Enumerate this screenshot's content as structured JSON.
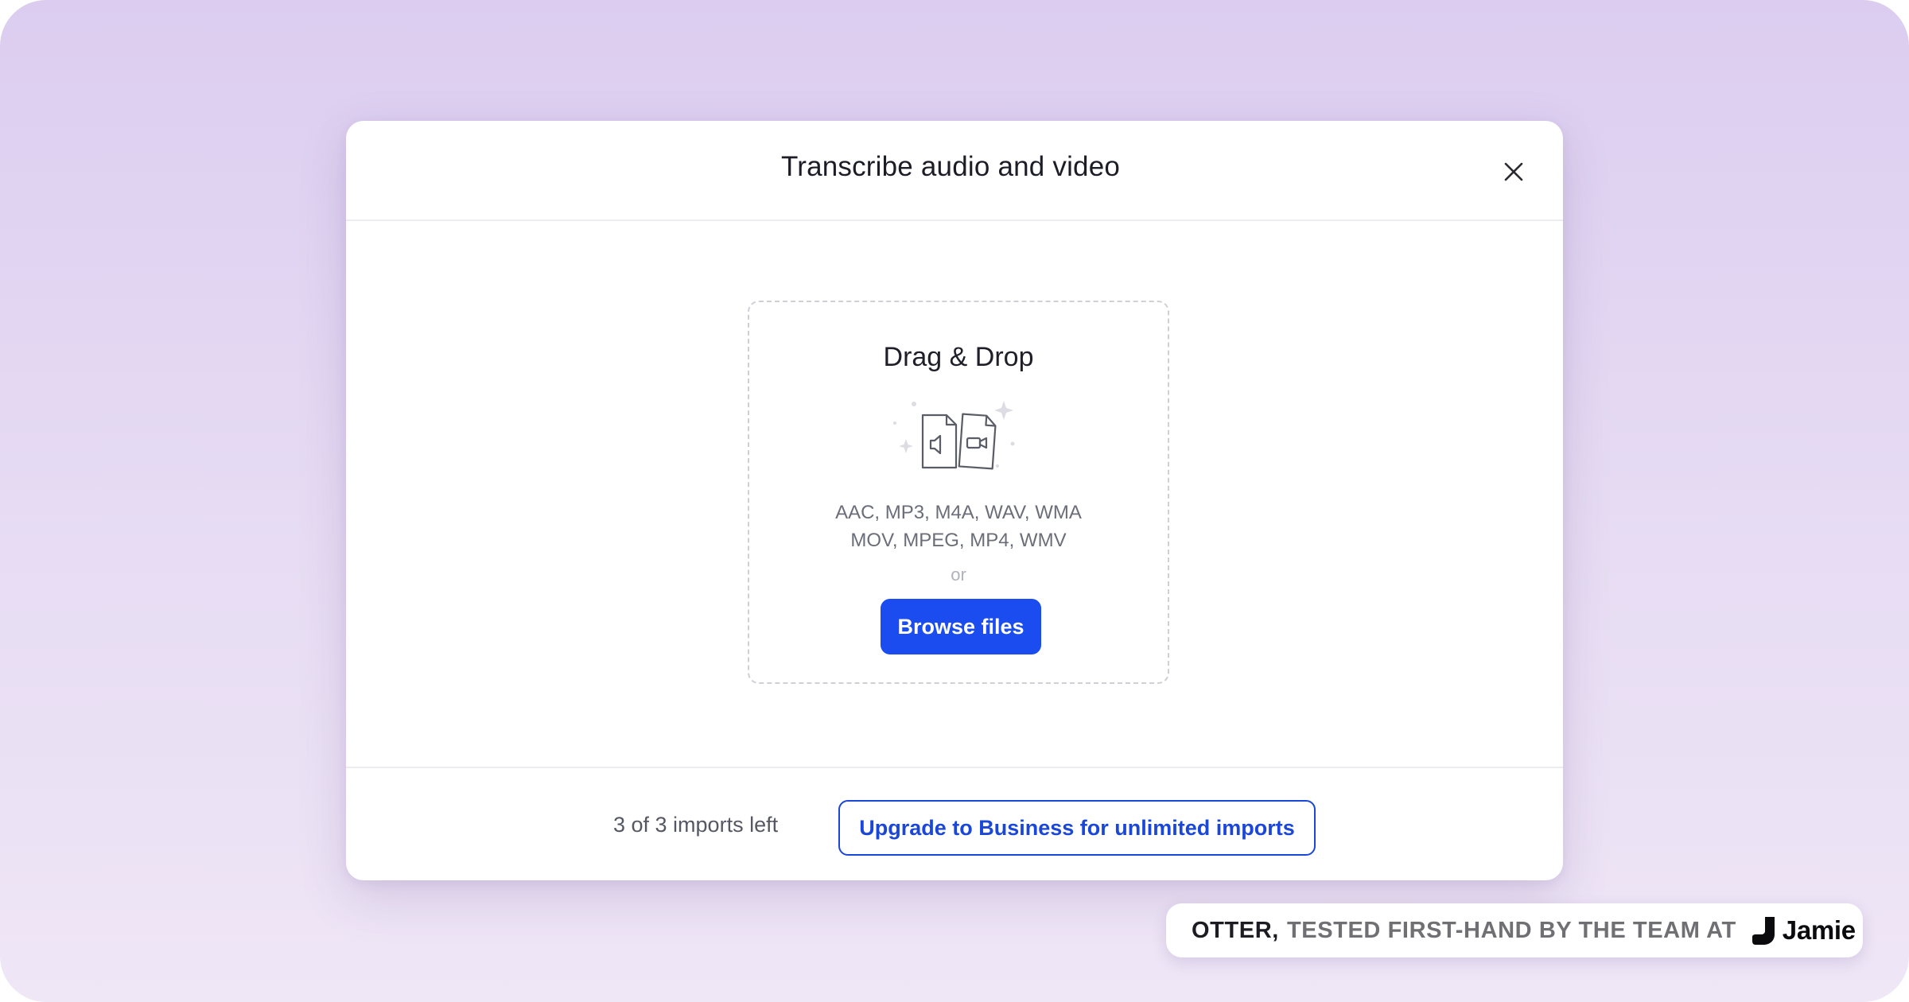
{
  "modal": {
    "title": "Transcribe audio and video",
    "close_icon": "close-icon"
  },
  "drop_zone": {
    "title": "Drag & Drop",
    "graphic_icons": [
      "audio-file-icon",
      "video-file-icon",
      "sparkle-icon"
    ],
    "formats_audio": "AAC, MP3, M4A, WAV, WMA",
    "formats_video": "MOV, MPEG, MP4, WMV",
    "or_label": "or",
    "browse_label": "Browse files"
  },
  "footer": {
    "imports_left": "3 of 3 imports left",
    "upgrade_label": "Upgrade to Business for unlimited imports"
  },
  "credit": {
    "product": "OTTER,",
    "text": "TESTED FIRST-HAND BY THE TEAM AT",
    "brand": "Jamie"
  },
  "colors": {
    "primary_button": "#1a4cf0",
    "outline_button": "#1a47d8",
    "background_top": "#dccdf0",
    "background_bottom": "#efe6f6"
  }
}
